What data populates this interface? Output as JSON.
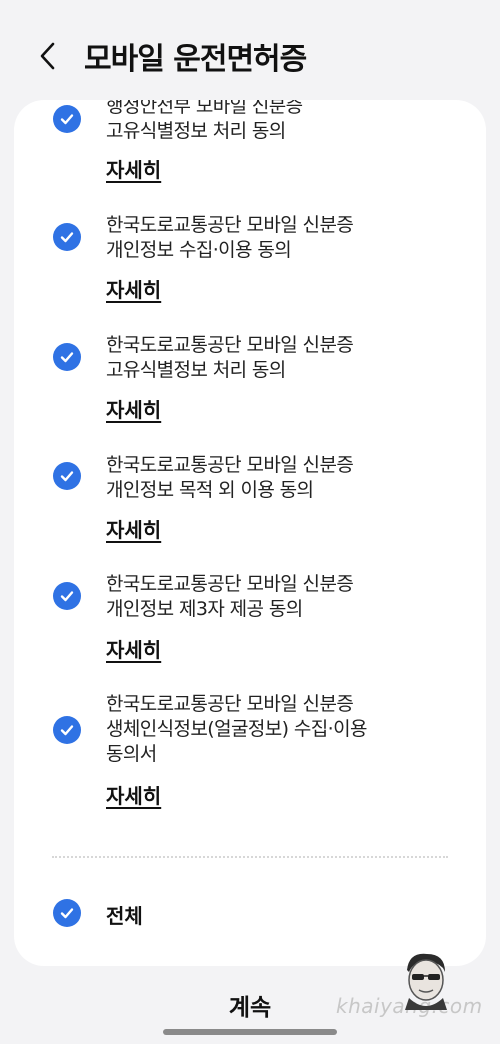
{
  "header": {
    "title": "모바일 운전면허증",
    "back_icon": "chevron-left-icon"
  },
  "items": [
    {
      "lines": [
        "행정안전부 모바일 신분증",
        "고유식별정보 처리 동의"
      ],
      "detail": "자세히",
      "checked": true
    },
    {
      "lines": [
        "한국도로교통공단 모바일 신분증",
        "개인정보 수집·이용 동의"
      ],
      "detail": "자세히",
      "checked": true
    },
    {
      "lines": [
        "한국도로교통공단 모바일 신분증",
        "고유식별정보 처리 동의"
      ],
      "detail": "자세히",
      "checked": true
    },
    {
      "lines": [
        "한국도로교통공단 모바일 신분증",
        "개인정보 목적 외 이용 동의"
      ],
      "detail": "자세히",
      "checked": true
    },
    {
      "lines": [
        "한국도로교통공단 모바일 신분증",
        "개인정보 제3자 제공 동의"
      ],
      "detail": "자세히",
      "checked": true
    },
    {
      "lines": [
        "한국도로교통공단 모바일 신분증",
        "생체인식정보(얼굴정보) 수집·이용",
        "동의서"
      ],
      "detail": "자세히",
      "checked": true
    }
  ],
  "all": {
    "label": "전체",
    "checked": true
  },
  "footer": {
    "continue_label": "계속",
    "watermark": "khaiyang.com"
  },
  "colors": {
    "accent": "#2f72e4",
    "background": "#f3f3f5",
    "card": "#ffffff"
  }
}
